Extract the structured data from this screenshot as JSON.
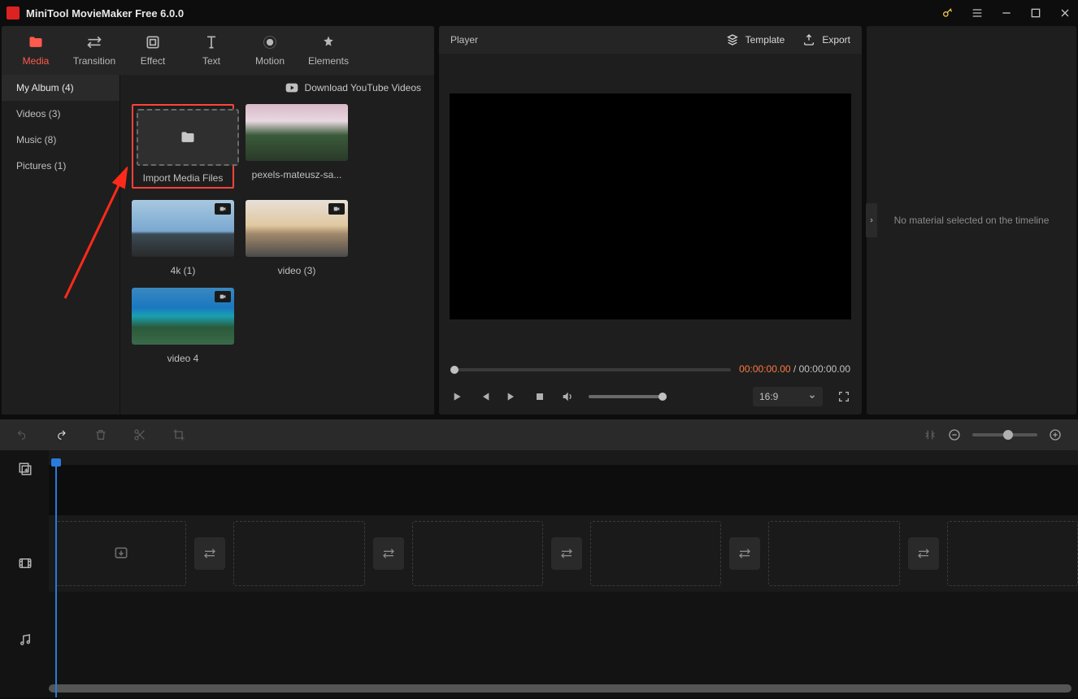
{
  "titlebar": {
    "title": "MiniTool MovieMaker Free 6.0.0"
  },
  "tabs": [
    {
      "label": "Media",
      "active": true
    },
    {
      "label": "Transition",
      "active": false
    },
    {
      "label": "Effect",
      "active": false
    },
    {
      "label": "Text",
      "active": false
    },
    {
      "label": "Motion",
      "active": false
    },
    {
      "label": "Elements",
      "active": false
    }
  ],
  "sidebar": [
    {
      "label": "My Album (4)",
      "active": true
    },
    {
      "label": "Videos (3)",
      "active": false
    },
    {
      "label": "Music (8)",
      "active": false
    },
    {
      "label": "Pictures (1)",
      "active": false
    }
  ],
  "download_link": "Download YouTube Videos",
  "thumbs": {
    "import": {
      "caption": "Import Media Files"
    },
    "item1": {
      "caption": "pexels-mateusz-sa..."
    },
    "item2": {
      "caption": "4k (1)"
    },
    "item3": {
      "caption": "video (3)"
    },
    "item4": {
      "caption": "video 4"
    }
  },
  "player": {
    "title": "Player",
    "template_label": "Template",
    "export_label": "Export",
    "time_current": "00:00:00.00",
    "time_sep": " / ",
    "time_total": "00:00:00.00",
    "ratio": "16:9"
  },
  "rightpanel": {
    "message": "No material selected on the timeline"
  }
}
